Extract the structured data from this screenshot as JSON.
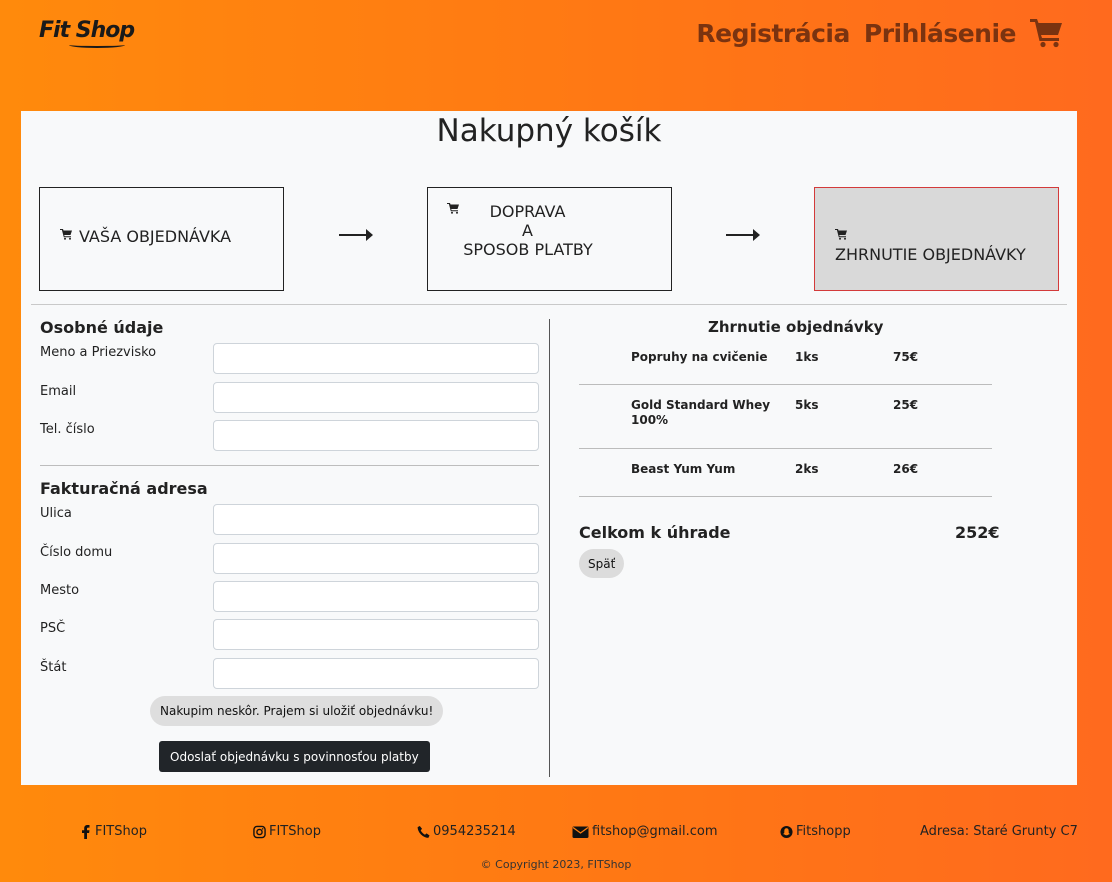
{
  "header": {
    "logo_fit": "Fit",
    "logo_shop": "Shop",
    "nav_register": "Registrácia",
    "nav_login": "Prihlásenie"
  },
  "page_title": "Nakupný košík",
  "steps": [
    {
      "label": "VAŠA OBJEDNÁVKA"
    },
    {
      "line1": "DOPRAVA",
      "line2": "A",
      "line3": "SPOSOB PLATBY"
    },
    {
      "label": "ZHRNUTIE OBJEDNÁVKY"
    }
  ],
  "personal": {
    "title": "Osobné údaje",
    "fields": [
      {
        "label": "Meno a Priezvisko",
        "value": ""
      },
      {
        "label": "Email",
        "value": ""
      },
      {
        "label": "Tel. číslo",
        "value": ""
      }
    ]
  },
  "billing": {
    "title": "Fakturačná adresa",
    "fields": [
      {
        "label": "Ulica",
        "value": ""
      },
      {
        "label": "Číslo domu",
        "value": ""
      },
      {
        "label": "Mesto",
        "value": ""
      },
      {
        "label": "PSČ",
        "value": ""
      },
      {
        "label": "Štát",
        "value": ""
      }
    ]
  },
  "buttons": {
    "later": "Nakupim neskôr. Prajem si uložiť objednávku!",
    "send": "Odoslať objednávku s povinnosťou platby",
    "back": "Späť"
  },
  "summary": {
    "title": "Zhrnutie objednávky",
    "items": [
      {
        "name": "Popruhy na cvičenie",
        "qty": "1ks",
        "price": "75€"
      },
      {
        "name": "Gold Standard Whey 100%",
        "qty": "5ks",
        "price": "25€"
      },
      {
        "name": "Beast Yum Yum",
        "qty": "2ks",
        "price": "26€"
      }
    ],
    "total_label": "Celkom k úhrade",
    "total_value": "252€"
  },
  "footer": {
    "facebook": "FITShop",
    "instagram": "FITShop",
    "phone": "0954235214",
    "email": "fitshop@gmail.com",
    "snapchat": "Fitshopp",
    "address": "Adresa: Staré Grunty C7",
    "copyright": "© Copyright 2023, FITShop"
  },
  "colors": {
    "accent_orange": "#ff7f11",
    "nav_text": "#7a3310",
    "active_step_border": "#d33a3a",
    "dark_button": "#212529"
  }
}
